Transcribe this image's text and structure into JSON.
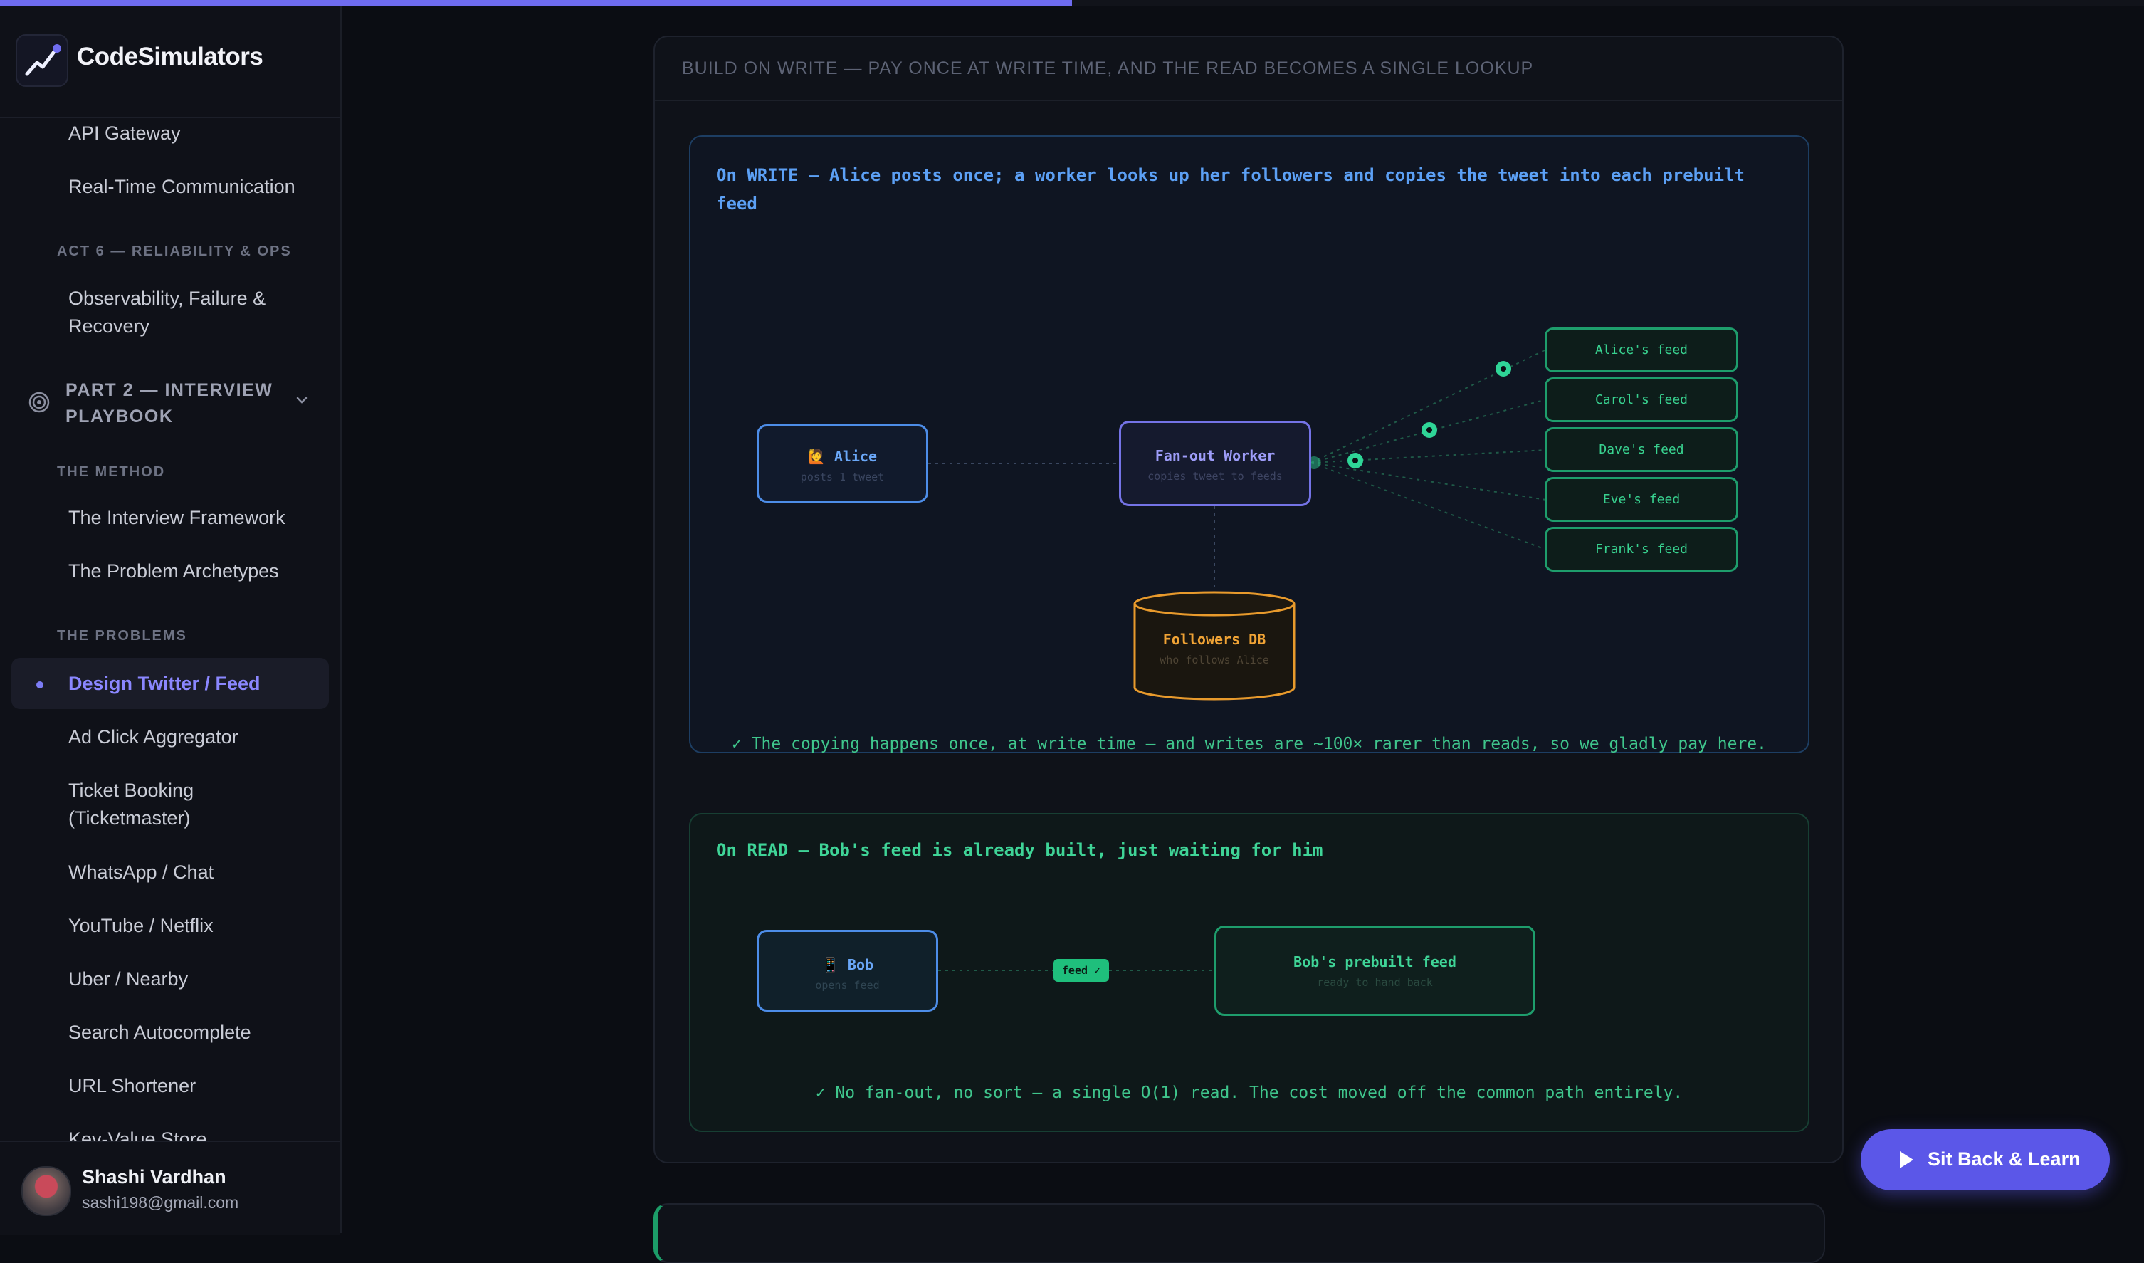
{
  "progress_fraction": 0.5,
  "brand": {
    "name": "CodeSimulators",
    "logo_icon": "chart-trend-icon"
  },
  "sidebar": {
    "items": [
      {
        "type": "item",
        "label": "API Gateway"
      },
      {
        "type": "item",
        "label": "Real-Time Communication"
      },
      {
        "type": "section",
        "label": "ACT 6 — RELIABILITY & OPS"
      },
      {
        "type": "item",
        "label": "Observability, Failure & Recovery"
      },
      {
        "type": "group",
        "label": "PART 2 — INTERVIEW PLAYBOOK",
        "icon": "target-icon",
        "expanded": true
      },
      {
        "type": "section",
        "label": "THE METHOD"
      },
      {
        "type": "item",
        "label": "The Interview Framework"
      },
      {
        "type": "item",
        "label": "The Problem Archetypes"
      },
      {
        "type": "section",
        "label": "THE PROBLEMS"
      },
      {
        "type": "item",
        "label": "Design Twitter / Feed",
        "active": true
      },
      {
        "type": "item",
        "label": "Ad Click Aggregator"
      },
      {
        "type": "item",
        "label": "Ticket Booking (Ticketmaster)"
      },
      {
        "type": "item",
        "label": "WhatsApp / Chat"
      },
      {
        "type": "item",
        "label": "YouTube / Netflix"
      },
      {
        "type": "item",
        "label": "Uber / Nearby"
      },
      {
        "type": "item",
        "label": "Search Autocomplete"
      },
      {
        "type": "item",
        "label": "URL Shortener"
      },
      {
        "type": "item",
        "label": "Key-Value Store"
      }
    ],
    "user": {
      "name": "Shashi Vardhan",
      "email": "sashi198@gmail.com"
    }
  },
  "panel": {
    "heading": "BUILD ON WRITE — PAY ONCE AT WRITE TIME, AND THE READ BECOMES A SINGLE LOOKUP",
    "write": {
      "title": "On WRITE — Alice posts once; a worker looks up her followers and copies the tweet into each prebuilt feed",
      "alice": {
        "label": "🙋 Alice",
        "sub": "posts 1 tweet"
      },
      "worker": {
        "label": "Fan-out Worker",
        "sub": "copies tweet to feeds"
      },
      "db": {
        "label": "Followers DB",
        "sub": "who follows Alice"
      },
      "feeds": [
        "Alice's feed",
        "Carol's feed",
        "Dave's feed",
        "Eve's feed",
        "Frank's feed"
      ],
      "note": "✓ The copying happens once, at write time — and writes are ~100× rarer than reads, so we gladly pay here."
    },
    "read": {
      "title": "On READ — Bob's feed is already built, just waiting for him",
      "bob": {
        "label": "📱 Bob",
        "sub": "opens feed"
      },
      "badge": "feed ✓",
      "feed": {
        "label": "Bob's prebuilt feed",
        "sub": "ready to hand back"
      },
      "note": "✓ No fan-out, no sort — a single O(1) read. The cost moved off the common path entirely."
    }
  },
  "cta": {
    "label": "Sit Back & Learn",
    "icon": "play-icon"
  },
  "colors": {
    "accent": "#5b57e8",
    "write_blue": "#5ca0f5",
    "read_green": "#3fd497",
    "db_orange": "#e89a2c"
  }
}
